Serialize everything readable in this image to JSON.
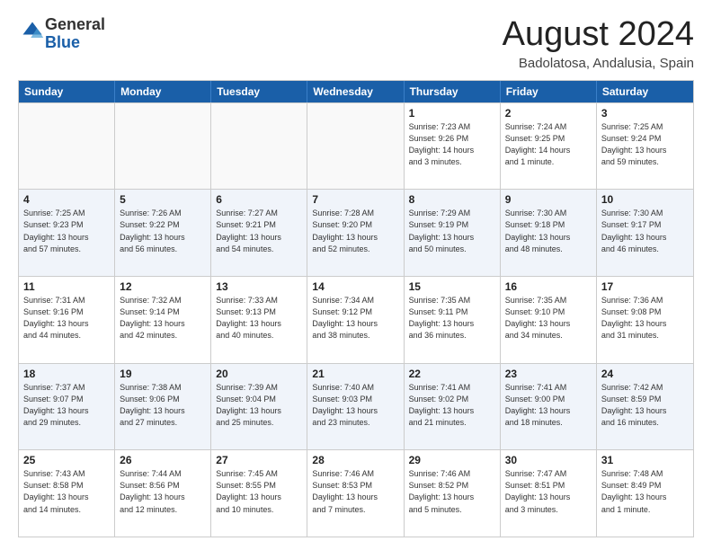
{
  "logo": {
    "general": "General",
    "blue": "Blue"
  },
  "header": {
    "month": "August 2024",
    "location": "Badolatosa, Andalusia, Spain"
  },
  "days": [
    "Sunday",
    "Monday",
    "Tuesday",
    "Wednesday",
    "Thursday",
    "Friday",
    "Saturday"
  ],
  "rows": [
    [
      {
        "day": "",
        "info": ""
      },
      {
        "day": "",
        "info": ""
      },
      {
        "day": "",
        "info": ""
      },
      {
        "day": "",
        "info": ""
      },
      {
        "day": "1",
        "info": "Sunrise: 7:23 AM\nSunset: 9:26 PM\nDaylight: 14 hours\nand 3 minutes."
      },
      {
        "day": "2",
        "info": "Sunrise: 7:24 AM\nSunset: 9:25 PM\nDaylight: 14 hours\nand 1 minute."
      },
      {
        "day": "3",
        "info": "Sunrise: 7:25 AM\nSunset: 9:24 PM\nDaylight: 13 hours\nand 59 minutes."
      }
    ],
    [
      {
        "day": "4",
        "info": "Sunrise: 7:25 AM\nSunset: 9:23 PM\nDaylight: 13 hours\nand 57 minutes."
      },
      {
        "day": "5",
        "info": "Sunrise: 7:26 AM\nSunset: 9:22 PM\nDaylight: 13 hours\nand 56 minutes."
      },
      {
        "day": "6",
        "info": "Sunrise: 7:27 AM\nSunset: 9:21 PM\nDaylight: 13 hours\nand 54 minutes."
      },
      {
        "day": "7",
        "info": "Sunrise: 7:28 AM\nSunset: 9:20 PM\nDaylight: 13 hours\nand 52 minutes."
      },
      {
        "day": "8",
        "info": "Sunrise: 7:29 AM\nSunset: 9:19 PM\nDaylight: 13 hours\nand 50 minutes."
      },
      {
        "day": "9",
        "info": "Sunrise: 7:30 AM\nSunset: 9:18 PM\nDaylight: 13 hours\nand 48 minutes."
      },
      {
        "day": "10",
        "info": "Sunrise: 7:30 AM\nSunset: 9:17 PM\nDaylight: 13 hours\nand 46 minutes."
      }
    ],
    [
      {
        "day": "11",
        "info": "Sunrise: 7:31 AM\nSunset: 9:16 PM\nDaylight: 13 hours\nand 44 minutes."
      },
      {
        "day": "12",
        "info": "Sunrise: 7:32 AM\nSunset: 9:14 PM\nDaylight: 13 hours\nand 42 minutes."
      },
      {
        "day": "13",
        "info": "Sunrise: 7:33 AM\nSunset: 9:13 PM\nDaylight: 13 hours\nand 40 minutes."
      },
      {
        "day": "14",
        "info": "Sunrise: 7:34 AM\nSunset: 9:12 PM\nDaylight: 13 hours\nand 38 minutes."
      },
      {
        "day": "15",
        "info": "Sunrise: 7:35 AM\nSunset: 9:11 PM\nDaylight: 13 hours\nand 36 minutes."
      },
      {
        "day": "16",
        "info": "Sunrise: 7:35 AM\nSunset: 9:10 PM\nDaylight: 13 hours\nand 34 minutes."
      },
      {
        "day": "17",
        "info": "Sunrise: 7:36 AM\nSunset: 9:08 PM\nDaylight: 13 hours\nand 31 minutes."
      }
    ],
    [
      {
        "day": "18",
        "info": "Sunrise: 7:37 AM\nSunset: 9:07 PM\nDaylight: 13 hours\nand 29 minutes."
      },
      {
        "day": "19",
        "info": "Sunrise: 7:38 AM\nSunset: 9:06 PM\nDaylight: 13 hours\nand 27 minutes."
      },
      {
        "day": "20",
        "info": "Sunrise: 7:39 AM\nSunset: 9:04 PM\nDaylight: 13 hours\nand 25 minutes."
      },
      {
        "day": "21",
        "info": "Sunrise: 7:40 AM\nSunset: 9:03 PM\nDaylight: 13 hours\nand 23 minutes."
      },
      {
        "day": "22",
        "info": "Sunrise: 7:41 AM\nSunset: 9:02 PM\nDaylight: 13 hours\nand 21 minutes."
      },
      {
        "day": "23",
        "info": "Sunrise: 7:41 AM\nSunset: 9:00 PM\nDaylight: 13 hours\nand 18 minutes."
      },
      {
        "day": "24",
        "info": "Sunrise: 7:42 AM\nSunset: 8:59 PM\nDaylight: 13 hours\nand 16 minutes."
      }
    ],
    [
      {
        "day": "25",
        "info": "Sunrise: 7:43 AM\nSunset: 8:58 PM\nDaylight: 13 hours\nand 14 minutes."
      },
      {
        "day": "26",
        "info": "Sunrise: 7:44 AM\nSunset: 8:56 PM\nDaylight: 13 hours\nand 12 minutes."
      },
      {
        "day": "27",
        "info": "Sunrise: 7:45 AM\nSunset: 8:55 PM\nDaylight: 13 hours\nand 10 minutes."
      },
      {
        "day": "28",
        "info": "Sunrise: 7:46 AM\nSunset: 8:53 PM\nDaylight: 13 hours\nand 7 minutes."
      },
      {
        "day": "29",
        "info": "Sunrise: 7:46 AM\nSunset: 8:52 PM\nDaylight: 13 hours\nand 5 minutes."
      },
      {
        "day": "30",
        "info": "Sunrise: 7:47 AM\nSunset: 8:51 PM\nDaylight: 13 hours\nand 3 minutes."
      },
      {
        "day": "31",
        "info": "Sunrise: 7:48 AM\nSunset: 8:49 PM\nDaylight: 13 hours\nand 1 minute."
      }
    ]
  ]
}
